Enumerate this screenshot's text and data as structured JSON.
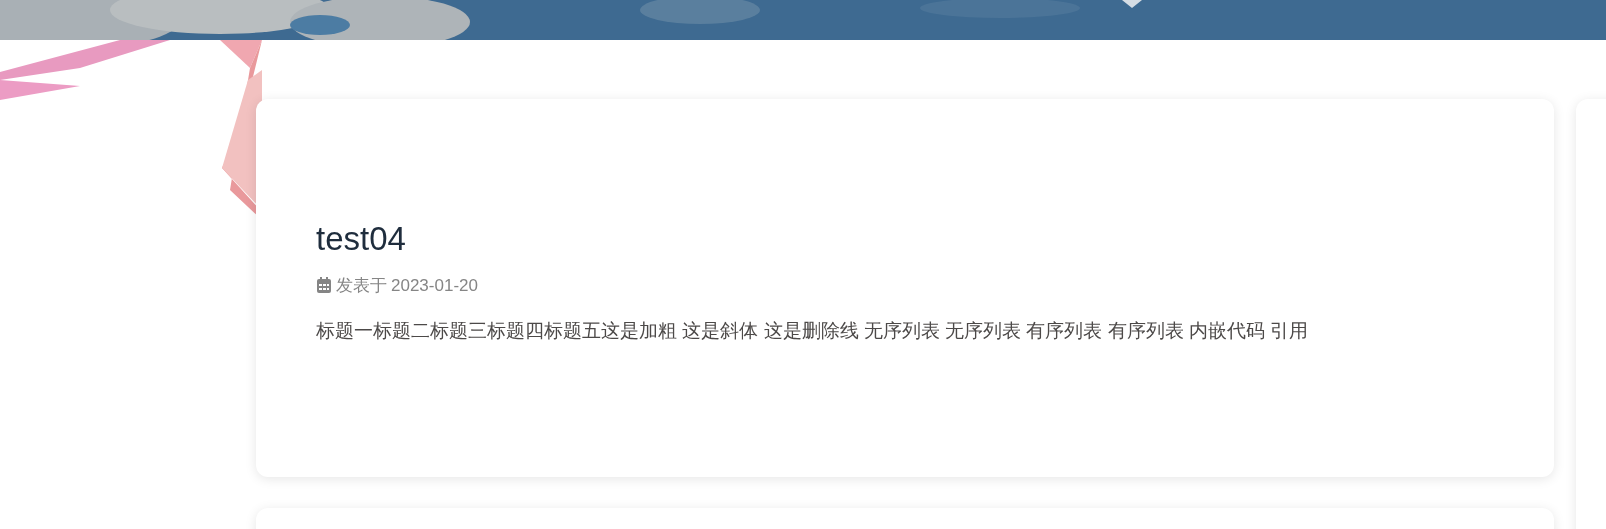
{
  "posts": [
    {
      "title": "test04",
      "meta_label": "发表于",
      "date": "2023-01-20",
      "excerpt": "标题一标题二标题三标题四标题五这是加粗 这是斜体 这是删除线 无序列表 无序列表 有序列表 有序列表 内嵌代码 引用"
    }
  ]
}
